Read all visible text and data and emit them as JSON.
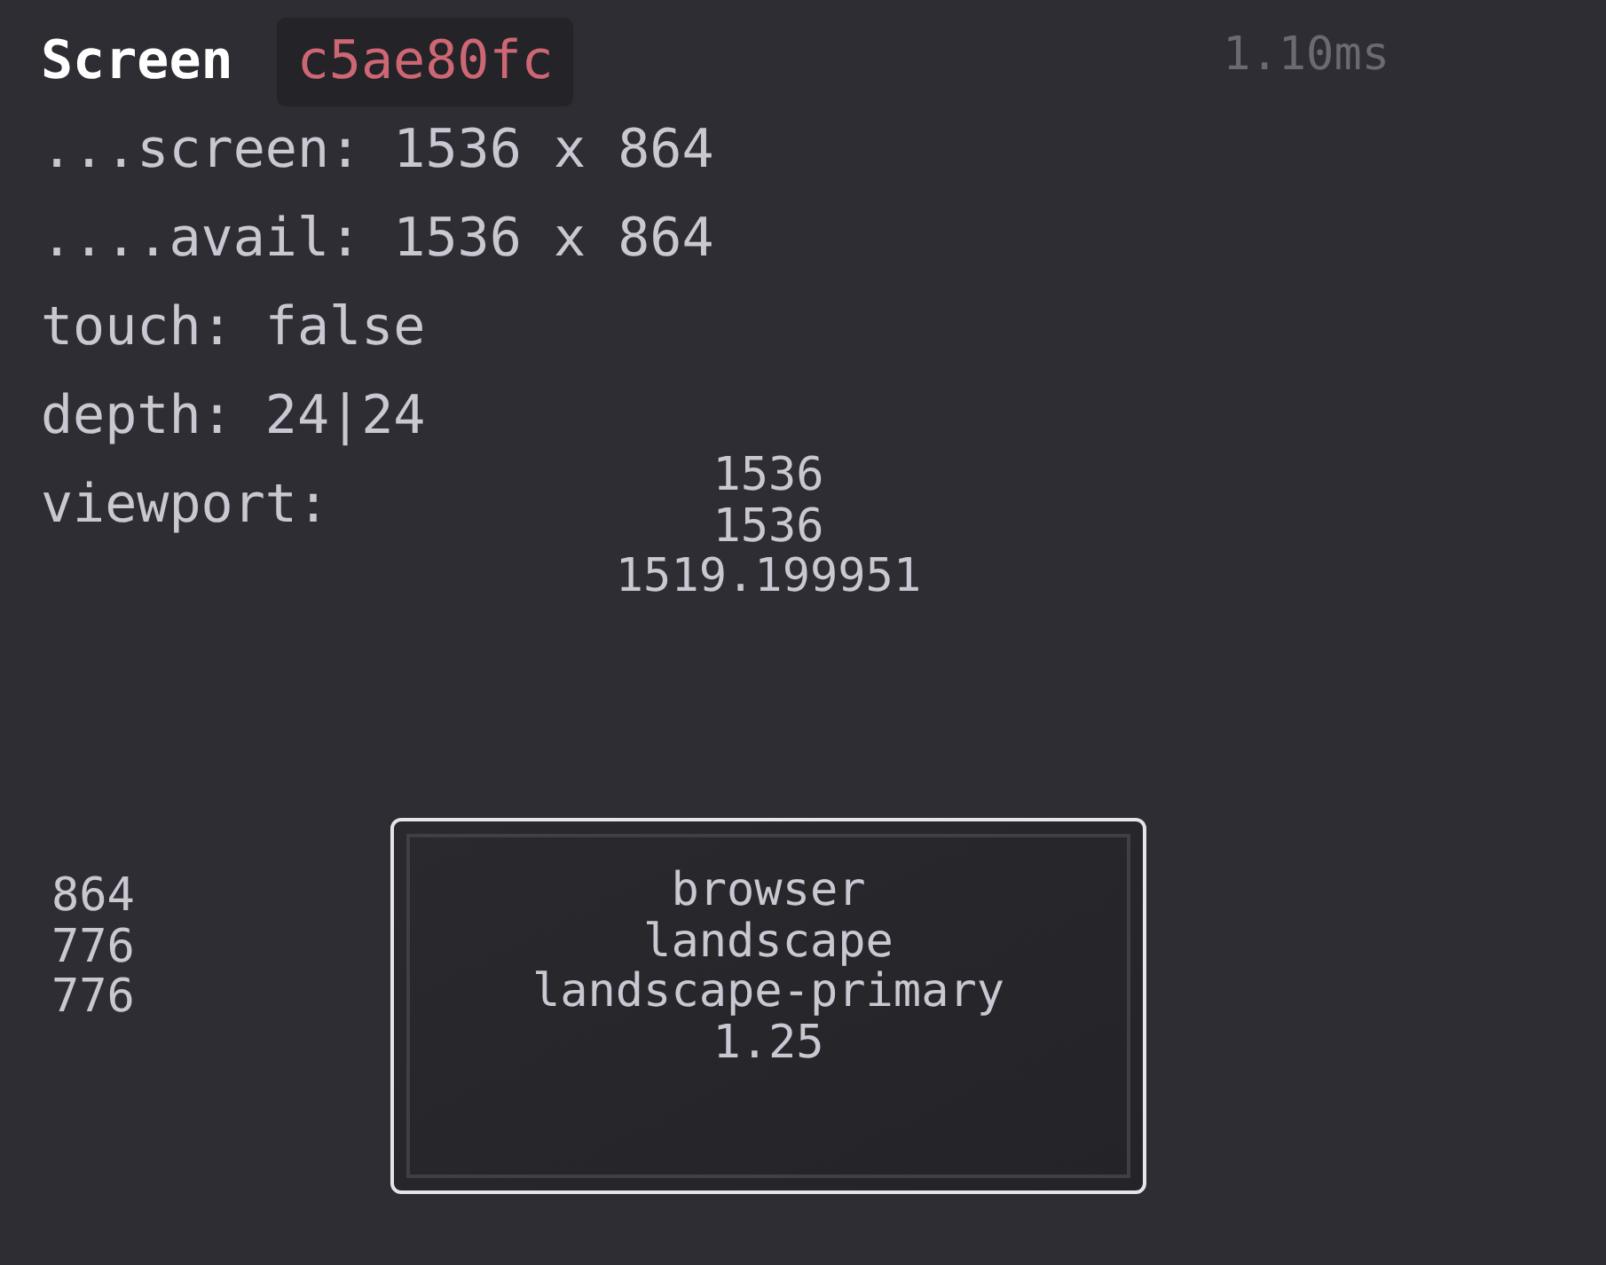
{
  "title": "Screen",
  "hash": "c5ae80fc",
  "time": "1.10ms",
  "lines": [
    "...screen: 1536 x 864",
    "....avail: 1536 x 864",
    "touch: false",
    "depth: 24|24"
  ],
  "viewport": {
    "label": "viewport:",
    "widths": [
      "1536",
      "1536",
      "1519.199951"
    ],
    "heights": [
      "864",
      "776",
      "776"
    ],
    "details": [
      "browser",
      "landscape",
      "landscape-primary",
      "1.25"
    ]
  }
}
